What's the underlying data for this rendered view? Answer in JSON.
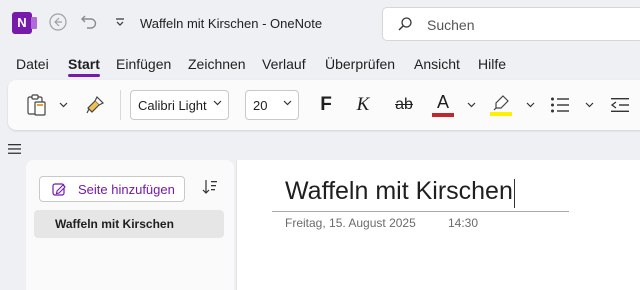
{
  "app": {
    "logo_letter": "N",
    "title": "Waffeln mit Kirschen  -  OneNote",
    "brand_color": "#7719aa"
  },
  "search": {
    "placeholder": "Suchen"
  },
  "menu": {
    "tabs": [
      {
        "label": "Datei"
      },
      {
        "label": "Start",
        "active": true
      },
      {
        "label": "Einfügen"
      },
      {
        "label": "Zeichnen"
      },
      {
        "label": "Verlauf"
      },
      {
        "label": "Überprüfen"
      },
      {
        "label": "Ansicht"
      },
      {
        "label": "Hilfe"
      }
    ]
  },
  "ribbon": {
    "font_name": "Calibri Light",
    "font_size": "20",
    "bold_label": "F",
    "italic_label": "K",
    "strike_label": "ab",
    "font_color_label": "A",
    "font_color": "#c4262e",
    "highlight_color": "#fff100",
    "icons": [
      "paste-icon",
      "format-painter-icon",
      "bullet-list-icon",
      "decrease-indent-icon"
    ]
  },
  "sidebar": {
    "add_page_label": "Seite hinzufügen",
    "pages": [
      {
        "label": "Waffeln mit Kirschen",
        "selected": true
      }
    ]
  },
  "page": {
    "title": "Waffeln mit Kirschen",
    "date": "Freitag, 15. August 2025",
    "time": "14:30"
  }
}
